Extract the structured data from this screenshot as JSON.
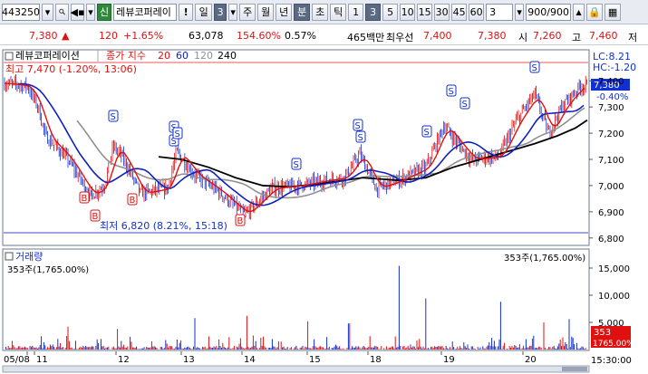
{
  "toolbar": {
    "code": "443250",
    "tag": "신",
    "name": "레뷰코퍼레이",
    "warn": "!",
    "period_label": "일",
    "period_value": "3",
    "periods": [
      "주",
      "월",
      "년",
      "분",
      "초",
      "틱"
    ],
    "minutes": [
      "1",
      "3",
      "5",
      "10",
      "15",
      "30",
      "45",
      "60"
    ],
    "active_minute": "3",
    "interval": "3",
    "count": "900/900",
    "icons": [
      "search-icon",
      "grid-icon",
      "speaker-icon",
      "chevron-down-icon",
      "chevron-up-icon",
      "lock-icon",
      "layout-icon",
      "refresh-icon"
    ]
  },
  "quote": {
    "price": "7,380",
    "arrow": "▲",
    "change": "120",
    "change_pct": "+1.65%",
    "volume": "63,078",
    "vol_ratio": "154.60%",
    "turnover": "0.57%",
    "amount": "465백만",
    "best_ask_label": "최우선",
    "best_ask": "7,400",
    "best_bid": "7,380",
    "open_label": "시",
    "open": "7,260",
    "high_label": "고",
    "high": "7,460",
    "low_label": "저"
  },
  "price_panel": {
    "legend_name": "레뷰코퍼레이션",
    "ma_label": "종가 지수",
    "ma_periods": [
      "20",
      "60",
      "120",
      "240"
    ],
    "high_note": "최고 7,470 (-1.20%, 13:06)",
    "low_note": "최저 6,820 (8.21%, 15:18)",
    "lc": "LC:8.21",
    "hc": "HC:-1.20",
    "cur_price_tag": "7,380",
    "cur_pct_tag": "-0.40%",
    "y_ticks": [
      "7,400",
      "7,300",
      "7,200",
      "7,100",
      "7,000",
      "6,900",
      "6,800"
    ],
    "marker_s": "S",
    "marker_b": "B"
  },
  "volume_panel": {
    "title": "거래량",
    "left_note": "353주(1,765.00%)",
    "right_note": "353주(1,765.00%)",
    "y_ticks": [
      "15,000",
      "10,000",
      "5,000"
    ],
    "cur_tag": "353",
    "cur_pct_tag": "1765.00%"
  },
  "x_axis": {
    "labels": [
      "05/08",
      "11",
      "12",
      "13",
      "14",
      "15",
      "18",
      "19",
      "20"
    ],
    "end_time": "15:30:00"
  },
  "colors": {
    "up": "#e01010",
    "down": "#1030d0",
    "ma20": "#e01010",
    "ma60": "#1020c0",
    "ma120": "#909090",
    "ma240": "#000000"
  }
}
